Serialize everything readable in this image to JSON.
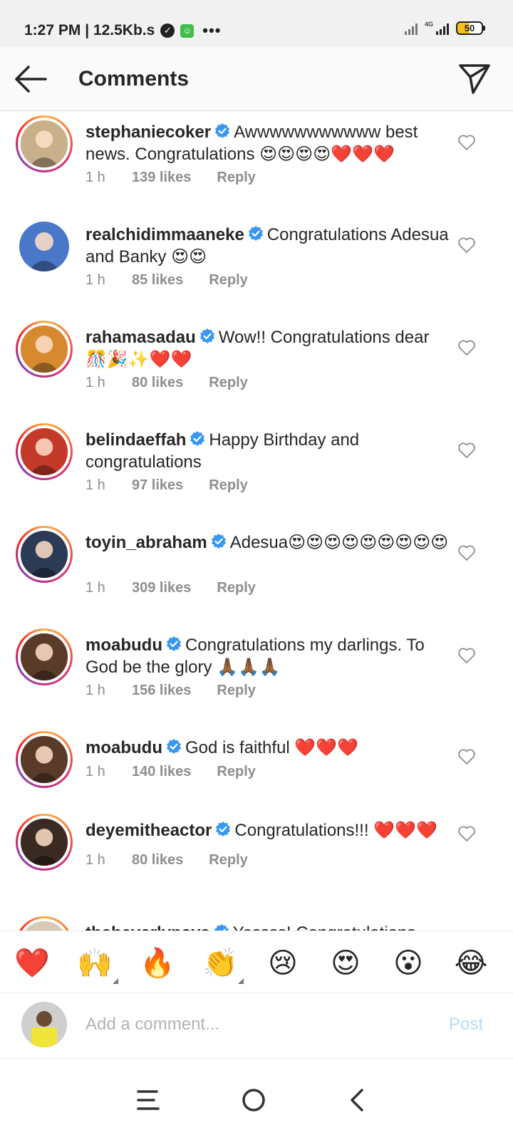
{
  "status_bar": {
    "time_speed": "1:27 PM | 12.5Kb.s",
    "dots": "•••",
    "network": "4G",
    "battery": "50"
  },
  "header": {
    "title": "Comments",
    "back_icon": "arrow-left-icon",
    "share_icon": "paper-plane-icon"
  },
  "comments": [
    {
      "username": "stephaniecoker",
      "text": "Awwwwwwwwwww best news. Congratulations 😍😍😍😍❤️❤️❤️",
      "time": "1 h",
      "likes": "139 likes",
      "reply": "Reply",
      "avatar_color": "#c9b08a"
    },
    {
      "username": "realchidimmaaneke",
      "text": "Congratulations Adesua and Banky 😍😍",
      "time": "1 h",
      "likes": "85 likes",
      "reply": "Reply",
      "avatar_color": "#4a78c8"
    },
    {
      "username": "rahamasadau",
      "text": "Wow!! Congratulations dear 🎊🎉✨❤️❤️",
      "time": "1 h",
      "likes": "80 likes",
      "reply": "Reply",
      "avatar_color": "#d7892f"
    },
    {
      "username": "belindaeffah",
      "text": "Happy Birthday and congratulations",
      "time": "1 h",
      "likes": "97 likes",
      "reply": "Reply",
      "avatar_color": "#c43a2a"
    },
    {
      "username": "toyin_abraham",
      "text": "Adesua😍😍😍😍😍😍😍😍😍",
      "time": "1 h",
      "likes": "309 likes",
      "reply": "Reply",
      "avatar_color": "#2b3a55"
    },
    {
      "username": "moabudu",
      "text": "Congratulations my darlings. To God be the glory 🙏🏾🙏🏾🙏🏾",
      "time": "1 h",
      "likes": "156 likes",
      "reply": "Reply",
      "avatar_color": "#5a3b2a"
    },
    {
      "username": "moabudu",
      "text": "God is faithful ❤️❤️❤️",
      "time": "1 h",
      "likes": "140 likes",
      "reply": "Reply",
      "avatar_color": "#5a3b2a"
    },
    {
      "username": "deyemitheactor",
      "text": "Congratulations!!! ❤️❤️❤️",
      "time": "1 h",
      "likes": "80 likes",
      "reply": "Reply",
      "avatar_color": "#3a2a22"
    },
    {
      "username": "thebeverlynaya",
      "text": "Yessss! Congratulations",
      "time": "",
      "likes": "",
      "reply": "",
      "avatar_color": "#d8c8b8"
    }
  ],
  "emoji_bar": [
    {
      "emoji": "❤️",
      "name": "heart"
    },
    {
      "emoji": "🙌",
      "name": "raising-hands"
    },
    {
      "emoji": "🔥",
      "name": "fire"
    },
    {
      "emoji": "👏",
      "name": "clapping-hands"
    },
    {
      "emoji": "😢",
      "name": "crying-face"
    },
    {
      "emoji": "😍",
      "name": "heart-eyes"
    },
    {
      "emoji": "😮",
      "name": "surprised-face"
    },
    {
      "emoji": "😂",
      "name": "tears-of-joy"
    }
  ],
  "composer": {
    "placeholder": "Add a comment...",
    "post_label": "Post"
  },
  "colors": {
    "verified": "#3897f0",
    "muted_text": "#8e8e8e",
    "post_disabled": "#b3dbff"
  }
}
